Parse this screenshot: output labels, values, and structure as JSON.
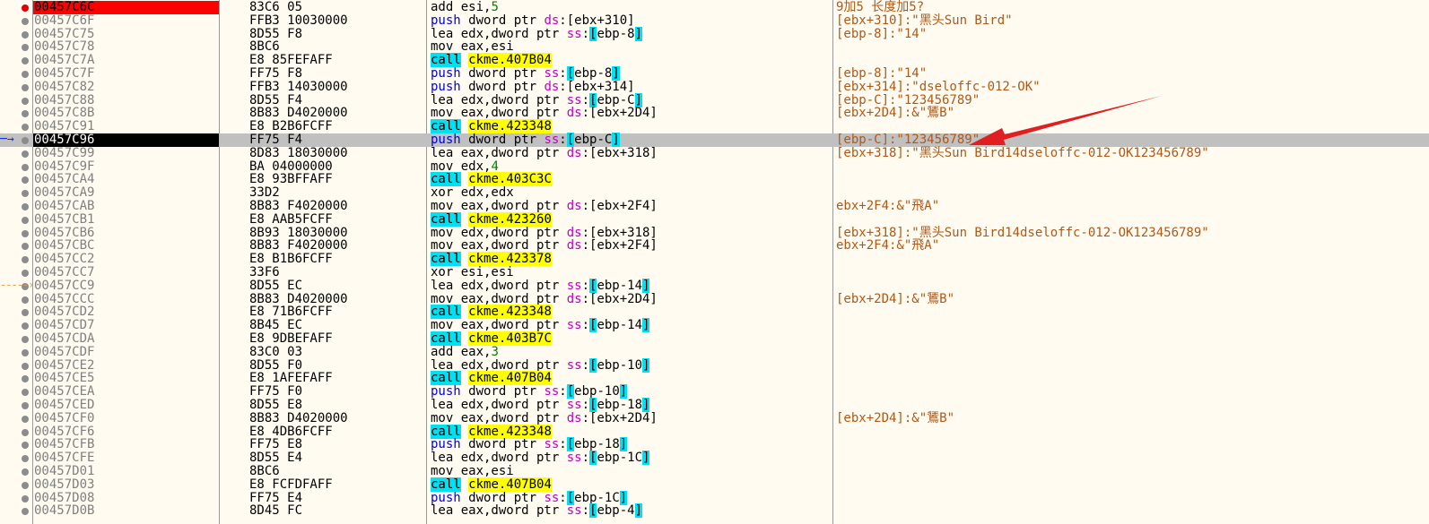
{
  "rows": [
    {
      "addr": "00457C6C",
      "bytes": "83C6 05",
      "instr": [
        {
          "t": "add"
        },
        {
          "t": " "
        },
        {
          "t": "esi",
          "c": "reg"
        },
        {
          "t": ","
        },
        {
          "t": "5",
          "c": "num"
        }
      ],
      "comment": "9加5 长度加5?",
      "mark": "bp"
    },
    {
      "addr": "00457C6F",
      "bytes": "FFB3 10030000",
      "instr": [
        {
          "t": "push",
          "c": "mn-push"
        },
        {
          "t": " dword ptr "
        },
        {
          "t": "ds",
          "c": "seg"
        },
        {
          "t": ":[ebx+310]"
        }
      ],
      "comment": "[ebx+310]:\"黑头Sun Bird\""
    },
    {
      "addr": "00457C75",
      "bytes": "8D55 F8",
      "instr": [
        {
          "t": "lea edx,dword ptr "
        },
        {
          "t": "ss",
          "c": "seg"
        },
        {
          "t": ":"
        },
        {
          "t": "[",
          "c": "brk"
        },
        {
          "t": "ebp-8"
        },
        {
          "t": "]",
          "c": "brk"
        }
      ],
      "comment": "[ebp-8]:\"14\""
    },
    {
      "addr": "00457C78",
      "bytes": "8BC6",
      "instr": [
        {
          "t": "mov eax,esi"
        }
      ],
      "comment": ""
    },
    {
      "addr": "00457C7A",
      "bytes": "E8 85FEFAFF",
      "instr": [
        {
          "t": "call",
          "c": "mn-call"
        },
        {
          "t": " "
        },
        {
          "t": "ckme.407B04",
          "c": "tgt"
        }
      ],
      "comment": ""
    },
    {
      "addr": "00457C7F",
      "bytes": "FF75 F8",
      "instr": [
        {
          "t": "push",
          "c": "mn-push"
        },
        {
          "t": " dword ptr "
        },
        {
          "t": "ss",
          "c": "seg"
        },
        {
          "t": ":"
        },
        {
          "t": "[",
          "c": "brk"
        },
        {
          "t": "ebp-8"
        },
        {
          "t": "]",
          "c": "brk"
        }
      ],
      "comment": "[ebp-8]:\"14\""
    },
    {
      "addr": "00457C82",
      "bytes": "FFB3 14030000",
      "instr": [
        {
          "t": "push",
          "c": "mn-push"
        },
        {
          "t": " dword ptr "
        },
        {
          "t": "ds",
          "c": "seg"
        },
        {
          "t": ":[ebx+314]"
        }
      ],
      "comment": "[ebx+314]:\"dseloffc-012-OK\""
    },
    {
      "addr": "00457C88",
      "bytes": "8D55 F4",
      "instr": [
        {
          "t": "lea edx,dword ptr "
        },
        {
          "t": "ss",
          "c": "seg"
        },
        {
          "t": ":"
        },
        {
          "t": "[",
          "c": "brk"
        },
        {
          "t": "ebp-C"
        },
        {
          "t": "]",
          "c": "brk"
        }
      ],
      "comment": "[ebp-C]:\"123456789\""
    },
    {
      "addr": "00457C8B",
      "bytes": "8B83 D4020000",
      "instr": [
        {
          "t": "mov eax,dword ptr "
        },
        {
          "t": "ds",
          "c": "seg"
        },
        {
          "t": ":[ebx+2D4]"
        }
      ],
      "comment": "[ebx+2D4]:&\"鵟B\""
    },
    {
      "addr": "00457C91",
      "bytes": "E8 B2B6FCFF",
      "instr": [
        {
          "t": "call",
          "c": "mn-call"
        },
        {
          "t": " "
        },
        {
          "t": "ckme.423348",
          "c": "tgt"
        }
      ],
      "comment": ""
    },
    {
      "addr": "00457C96",
      "bytes": "FF75 F4",
      "instr": [
        {
          "t": "push",
          "c": "mn-push"
        },
        {
          "t": " dword ptr "
        },
        {
          "t": "ss",
          "c": "seg"
        },
        {
          "t": ":"
        },
        {
          "t": "[",
          "c": "brk"
        },
        {
          "t": "ebp-C"
        },
        {
          "t": "]",
          "c": "brk"
        }
      ],
      "comment": "[ebp-C]:\"123456789\"",
      "mark": "eip"
    },
    {
      "addr": "00457C99",
      "bytes": "8D83 18030000",
      "instr": [
        {
          "t": "lea eax,dword ptr "
        },
        {
          "t": "ds",
          "c": "seg"
        },
        {
          "t": ":[ebx+318]"
        }
      ],
      "comment": "[ebx+318]:\"黑头Sun Bird14dseloffc-012-OK123456789\""
    },
    {
      "addr": "00457C9F",
      "bytes": "BA 04000000",
      "instr": [
        {
          "t": "mov edx,"
        },
        {
          "t": "4",
          "c": "num"
        }
      ],
      "comment": ""
    },
    {
      "addr": "00457CA4",
      "bytes": "E8 93BFFAFF",
      "instr": [
        {
          "t": "call",
          "c": "mn-call"
        },
        {
          "t": " "
        },
        {
          "t": "ckme.403C3C",
          "c": "tgt"
        }
      ],
      "comment": ""
    },
    {
      "addr": "00457CA9",
      "bytes": "33D2",
      "instr": [
        {
          "t": "xor edx,edx"
        }
      ],
      "comment": ""
    },
    {
      "addr": "00457CAB",
      "bytes": "8B83 F4020000",
      "instr": [
        {
          "t": "mov eax,dword ptr "
        },
        {
          "t": "ds",
          "c": "seg"
        },
        {
          "t": ":[ebx+2F4]"
        }
      ],
      "comment": "ebx+2F4:&\"飛A\""
    },
    {
      "addr": "00457CB1",
      "bytes": "E8 AAB5FCFF",
      "instr": [
        {
          "t": "call",
          "c": "mn-call"
        },
        {
          "t": " "
        },
        {
          "t": "ckme.423260",
          "c": "tgt"
        }
      ],
      "comment": ""
    },
    {
      "addr": "00457CB6",
      "bytes": "8B93 18030000",
      "instr": [
        {
          "t": "mov edx,dword ptr "
        },
        {
          "t": "ds",
          "c": "seg"
        },
        {
          "t": ":[ebx+318]"
        }
      ],
      "comment": "[ebx+318]:\"黑头Sun Bird14dseloffc-012-OK123456789\""
    },
    {
      "addr": "00457CBC",
      "bytes": "8B83 F4020000",
      "instr": [
        {
          "t": "mov eax,dword ptr "
        },
        {
          "t": "ds",
          "c": "seg"
        },
        {
          "t": ":[ebx+2F4]"
        }
      ],
      "comment": "ebx+2F4:&\"飛A\""
    },
    {
      "addr": "00457CC2",
      "bytes": "E8 B1B6FCFF",
      "instr": [
        {
          "t": "call",
          "c": "mn-call"
        },
        {
          "t": " "
        },
        {
          "t": "ckme.423378",
          "c": "tgt"
        }
      ],
      "comment": ""
    },
    {
      "addr": "00457CC7",
      "bytes": "33F6",
      "instr": [
        {
          "t": "xor esi,esi"
        }
      ],
      "comment": ""
    },
    {
      "addr": "00457CC9",
      "bytes": "8D55 EC",
      "instr": [
        {
          "t": "lea edx,dword ptr "
        },
        {
          "t": "ss",
          "c": "seg"
        },
        {
          "t": ":"
        },
        {
          "t": "[",
          "c": "brk"
        },
        {
          "t": "ebp-14"
        },
        {
          "t": "]",
          "c": "brk"
        }
      ],
      "comment": "",
      "mark": "jmp"
    },
    {
      "addr": "00457CCC",
      "bytes": "8B83 D4020000",
      "instr": [
        {
          "t": "mov eax,dword ptr "
        },
        {
          "t": "ds",
          "c": "seg"
        },
        {
          "t": ":[ebx+2D4]"
        }
      ],
      "comment": "[ebx+2D4]:&\"鵟B\""
    },
    {
      "addr": "00457CD2",
      "bytes": "E8 71B6FCFF",
      "instr": [
        {
          "t": "call",
          "c": "mn-call"
        },
        {
          "t": " "
        },
        {
          "t": "ckme.423348",
          "c": "tgt"
        }
      ],
      "comment": ""
    },
    {
      "addr": "00457CD7",
      "bytes": "8B45 EC",
      "instr": [
        {
          "t": "mov eax,dword ptr "
        },
        {
          "t": "ss",
          "c": "seg"
        },
        {
          "t": ":"
        },
        {
          "t": "[",
          "c": "brk"
        },
        {
          "t": "ebp-14"
        },
        {
          "t": "]",
          "c": "brk"
        }
      ],
      "comment": ""
    },
    {
      "addr": "00457CDA",
      "bytes": "E8 9DBEFAFF",
      "instr": [
        {
          "t": "call",
          "c": "mn-call"
        },
        {
          "t": " "
        },
        {
          "t": "ckme.403B7C",
          "c": "tgt"
        }
      ],
      "comment": ""
    },
    {
      "addr": "00457CDF",
      "bytes": "83C0 03",
      "instr": [
        {
          "t": "add eax,"
        },
        {
          "t": "3",
          "c": "num"
        }
      ],
      "comment": ""
    },
    {
      "addr": "00457CE2",
      "bytes": "8D55 F0",
      "instr": [
        {
          "t": "lea edx,dword ptr "
        },
        {
          "t": "ss",
          "c": "seg"
        },
        {
          "t": ":"
        },
        {
          "t": "[",
          "c": "brk"
        },
        {
          "t": "ebp-10"
        },
        {
          "t": "]",
          "c": "brk"
        }
      ],
      "comment": ""
    },
    {
      "addr": "00457CE5",
      "bytes": "E8 1AFEFAFF",
      "instr": [
        {
          "t": "call",
          "c": "mn-call"
        },
        {
          "t": " "
        },
        {
          "t": "ckme.407B04",
          "c": "tgt"
        }
      ],
      "comment": ""
    },
    {
      "addr": "00457CEA",
      "bytes": "FF75 F0",
      "instr": [
        {
          "t": "push",
          "c": "mn-push"
        },
        {
          "t": " dword ptr "
        },
        {
          "t": "ss",
          "c": "seg"
        },
        {
          "t": ":"
        },
        {
          "t": "[",
          "c": "brk"
        },
        {
          "t": "ebp-10"
        },
        {
          "t": "]",
          "c": "brk"
        }
      ],
      "comment": ""
    },
    {
      "addr": "00457CED",
      "bytes": "8D55 E8",
      "instr": [
        {
          "t": "lea edx,dword ptr "
        },
        {
          "t": "ss",
          "c": "seg"
        },
        {
          "t": ":"
        },
        {
          "t": "[",
          "c": "brk"
        },
        {
          "t": "ebp-18"
        },
        {
          "t": "]",
          "c": "brk"
        }
      ],
      "comment": ""
    },
    {
      "addr": "00457CF0",
      "bytes": "8B83 D4020000",
      "instr": [
        {
          "t": "mov eax,dword ptr "
        },
        {
          "t": "ds",
          "c": "seg"
        },
        {
          "t": ":[ebx+2D4]"
        }
      ],
      "comment": "[ebx+2D4]:&\"鵟B\""
    },
    {
      "addr": "00457CF6",
      "bytes": "E8 4DB6FCFF",
      "instr": [
        {
          "t": "call",
          "c": "mn-call"
        },
        {
          "t": " "
        },
        {
          "t": "ckme.423348",
          "c": "tgt"
        }
      ],
      "comment": ""
    },
    {
      "addr": "00457CFB",
      "bytes": "FF75 E8",
      "instr": [
        {
          "t": "push",
          "c": "mn-push"
        },
        {
          "t": " dword ptr "
        },
        {
          "t": "ss",
          "c": "seg"
        },
        {
          "t": ":"
        },
        {
          "t": "[",
          "c": "brk"
        },
        {
          "t": "ebp-18"
        },
        {
          "t": "]",
          "c": "brk"
        }
      ],
      "comment": ""
    },
    {
      "addr": "00457CFE",
      "bytes": "8D55 E4",
      "instr": [
        {
          "t": "lea edx,dword ptr "
        },
        {
          "t": "ss",
          "c": "seg"
        },
        {
          "t": ":"
        },
        {
          "t": "[",
          "c": "brk"
        },
        {
          "t": "ebp-1C"
        },
        {
          "t": "]",
          "c": "brk"
        }
      ],
      "comment": ""
    },
    {
      "addr": "00457D01",
      "bytes": "8BC6",
      "instr": [
        {
          "t": "mov eax,esi"
        }
      ],
      "comment": ""
    },
    {
      "addr": "00457D03",
      "bytes": "E8 FCFDFAFF",
      "instr": [
        {
          "t": "call",
          "c": "mn-call"
        },
        {
          "t": " "
        },
        {
          "t": "ckme.407B04",
          "c": "tgt"
        }
      ],
      "comment": ""
    },
    {
      "addr": "00457D08",
      "bytes": "FF75 E4",
      "instr": [
        {
          "t": "push",
          "c": "mn-push"
        },
        {
          "t": " dword ptr "
        },
        {
          "t": "ss",
          "c": "seg"
        },
        {
          "t": ":"
        },
        {
          "t": "[",
          "c": "brk"
        },
        {
          "t": "ebp-1C"
        },
        {
          "t": "]",
          "c": "brk"
        }
      ],
      "comment": ""
    },
    {
      "addr": "00457D0B",
      "bytes": "8D45 FC",
      "instr": [
        {
          "t": "lea eax,dword ptr "
        },
        {
          "t": "ss",
          "c": "seg"
        },
        {
          "t": ":"
        },
        {
          "t": "[",
          "c": "brk"
        },
        {
          "t": "ebp-4"
        },
        {
          "t": "]",
          "c": "brk"
        }
      ],
      "comment": ""
    }
  ],
  "colors": {
    "background": "#fffbf0",
    "breakpoint": "#ff0000",
    "eip_address_bg": "#000000",
    "current_row_bg": "#c0c0c0",
    "call_highlight": "#00e0f0",
    "call_target_highlight": "#ffff00",
    "comment": "#b05818",
    "push_mnemonic": "#0000e0",
    "segment": "#c000c0",
    "annotation_arrow": "#e02020"
  },
  "icons": {
    "breakpoint": "breakpoint-dot-icon",
    "bullet": "bullet-dot-icon",
    "current_instruction": "eip-arrow-icon",
    "jump_target": "jump-arrow-icon",
    "annotation": "red-annotation-arrow"
  }
}
